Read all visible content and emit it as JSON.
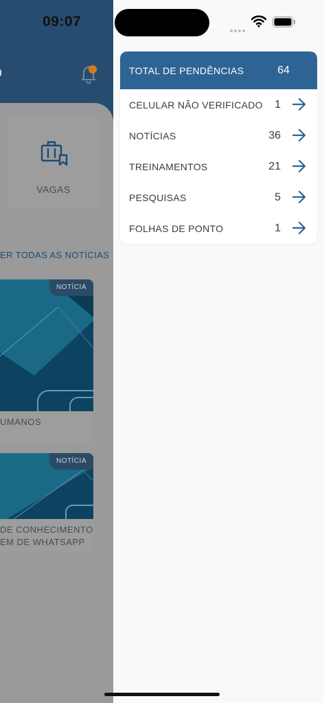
{
  "status_bar": {
    "time": "09:07"
  },
  "background": {
    "card_label": "VAGAS",
    "see_all_news": "ER TODAS AS NOTÍCIAS",
    "news": [
      {
        "badge": "NOTÍCIA",
        "lines": [
          "UMANOS"
        ]
      },
      {
        "badge": "NOTÍCIA",
        "lines": [
          "DE CONHECIMENTO -",
          "EM DE WHATSAPP"
        ]
      }
    ]
  },
  "pendencies": {
    "title": "TOTAL DE PENDÊNCIAS",
    "total": "64",
    "items": [
      {
        "label": "CELULAR NÃO VERIFICADO",
        "count": "1"
      },
      {
        "label": "NOTÍCIAS",
        "count": "36"
      },
      {
        "label": "TREINAMENTOS",
        "count": "21"
      },
      {
        "label": "PESQUISAS",
        "count": "5"
      },
      {
        "label": "FOLHAS DE PONTO",
        "count": "1"
      }
    ]
  },
  "colors": {
    "accent": "#2d6494",
    "notification_dot": "#d87a1a"
  }
}
